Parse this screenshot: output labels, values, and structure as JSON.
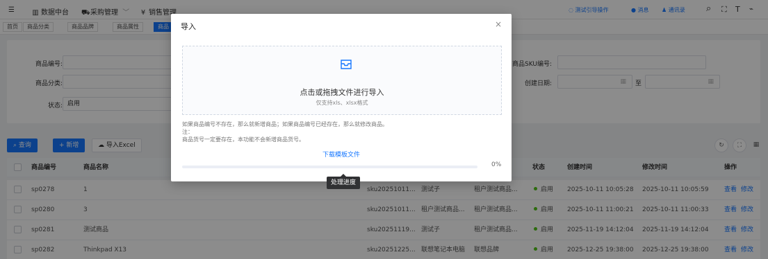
{
  "topbar": {
    "menu_icon": "☰",
    "nav": [
      {
        "icon": "chart-icon",
        "glyph": "▥",
        "label": "数据中台"
      },
      {
        "icon": "cart-icon",
        "glyph": "⛟",
        "label": "采购管理",
        "caret": "﹀"
      },
      {
        "icon": "yen-icon",
        "glyph": "¥",
        "label": "销售管理"
      }
    ],
    "right": {
      "guide": "测试引导操作",
      "message": "消息",
      "user": "通讯录"
    }
  },
  "tags": [
    "首页",
    "商品分类",
    "商品品牌",
    "商品属性",
    "商品"
  ],
  "search": {
    "code_label": "商品编号:",
    "category_label": "商品分类:",
    "status_label": "状态:",
    "status_value": "启用",
    "sku_label": "商品SKU编号:",
    "date_label": "创建日期:",
    "date_sep": "至"
  },
  "toolbar": {
    "query": "查询",
    "add": "新增",
    "import": "导入Excel"
  },
  "table": {
    "headers": {
      "code": "商品编号",
      "name": "商品名称",
      "status": "状态",
      "created": "创建时间",
      "modified": "修改时间",
      "ops": "操作"
    },
    "rows": [
      {
        "code": "sp0278",
        "name": "1",
        "sku": "sku20251011...",
        "cat": "测试子",
        "brand": "租户测试商品...",
        "status": "启用",
        "created": "2025-10-11 10:05:28",
        "modified": "2025-10-11 10:05:59"
      },
      {
        "code": "sp0280",
        "name": "3",
        "sku": "sku20251011...",
        "cat": "租户测试商品...",
        "brand": "租户测试商品...",
        "status": "启用",
        "created": "2025-10-11 11:00:21",
        "modified": "2025-10-11 11:00:33"
      },
      {
        "code": "sp0281",
        "name": "测试商品",
        "sku": "sku20251119...",
        "cat": "测试子",
        "brand": "租户测试商品...",
        "status": "启用",
        "created": "2025-11-19 14:12:04",
        "modified": "2025-11-19 14:12:04"
      },
      {
        "code": "sp0282",
        "name": "Thinkpad X13",
        "sku": "sku20251225...",
        "cat": "联想笔记本电脑",
        "brand": "联想品牌",
        "status": "启用",
        "created": "2025-12-25 19:38:00",
        "modified": "2025-12-25 19:38:00"
      }
    ],
    "view": "查看",
    "edit": "修改"
  },
  "modal": {
    "title": "导入",
    "close": "×",
    "drop_text": "点击或拖拽文件进行导入",
    "drop_tip": "仅支持xls、xlsx格式",
    "note1": "如果商品编号不存在，那么就新增商品；如果商品编号已经存在，那么就修改商品。",
    "note2": "注：",
    "note3": "商品货号一定要存在，本功能不会新增商品货号。",
    "download": "下载模板文件",
    "progress_pct": "0%",
    "progress_value": 0,
    "tooltip": "处理进度"
  },
  "colors": {
    "primary": "#1677ff",
    "status_enabled": "#52c41a"
  }
}
